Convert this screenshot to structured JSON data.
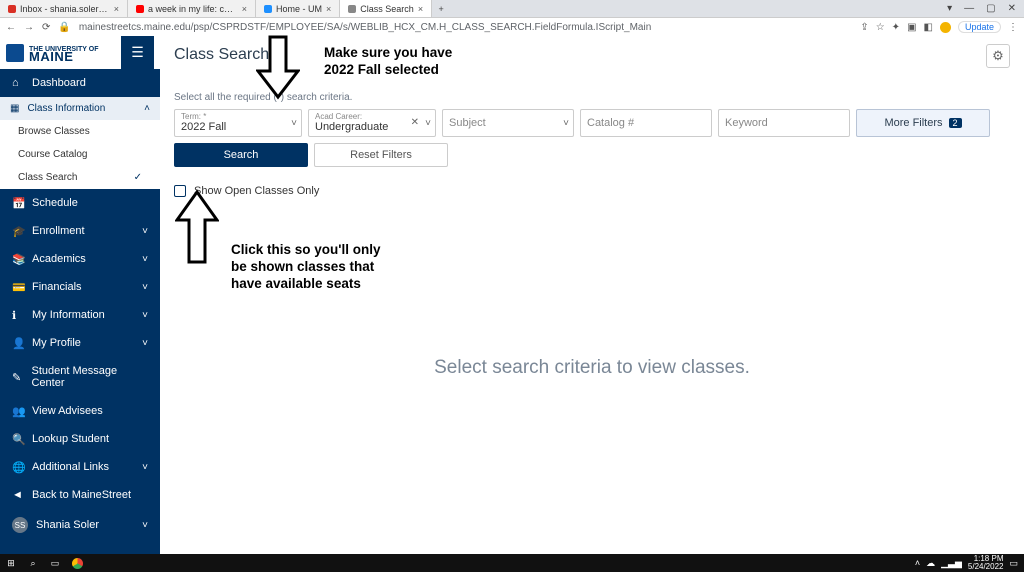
{
  "tabs": [
    {
      "title": "Inbox - shania.soler@maine.edu",
      "fav": "#d93025"
    },
    {
      "title": "a week in my life: college fin…",
      "fav": "#ff0000"
    },
    {
      "title": "Home - UM",
      "fav": "#1e90ff"
    },
    {
      "title": "Class Search",
      "fav": "#888",
      "active": true
    }
  ],
  "url": "mainestreetcs.maine.edu/psp/CSPRDSTF/EMPLOYEE/SA/s/WEBLIB_HCX_CM.H_CLASS_SEARCH.FieldFormula.IScript_Main",
  "update_label": "Update",
  "logo": {
    "small": "THE UNIVERSITY OF",
    "big": "MAINE"
  },
  "sidebar": {
    "dashboard": "Dashboard",
    "class_info": "Class Information",
    "sub": {
      "browse": "Browse Classes",
      "catalog": "Course Catalog",
      "search": "Class Search"
    },
    "items": [
      "Schedule",
      "Enrollment",
      "Academics",
      "Financials",
      "My Information",
      "My Profile",
      "Student Message Center",
      "View Advisees",
      "Lookup Student",
      "Additional Links",
      "Back to MaineStreet"
    ],
    "user_initials": "SS",
    "user_name": "Shania Soler"
  },
  "page": {
    "title": "Class Search",
    "hint": "Select all the required (*) search criteria.",
    "term_label": "Term: *",
    "term_value": "2022 Fall",
    "career_label": "Acad Career:",
    "career_value": "Undergraduate",
    "subject_ph": "Subject",
    "catalog_ph": "Catalog #",
    "keyword_ph": "Keyword",
    "more_label": "More Filters",
    "more_count": "2",
    "search_label": "Search",
    "reset_label": "Reset Filters",
    "open_only": "Show Open Classes Only",
    "empty": "Select search criteria to view classes."
  },
  "annotations": {
    "top": "Make sure you have\n2022 Fall selected",
    "bottom": "Click this so you'll only\nbe shown classes that\nhave available seats"
  },
  "taskbar": {
    "time": "1:18 PM",
    "date": "5/24/2022"
  }
}
